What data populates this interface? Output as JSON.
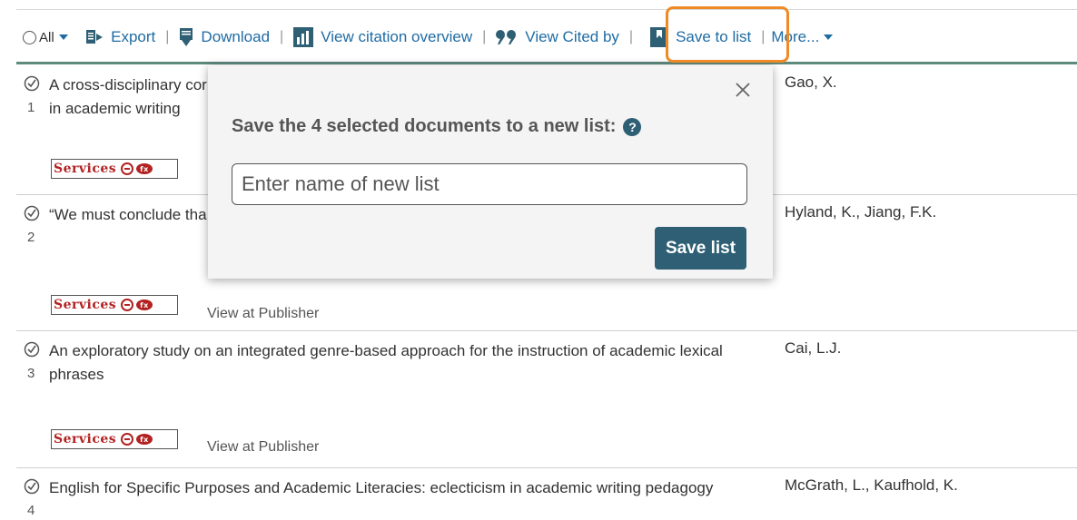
{
  "toolbar": {
    "select_all_label": "All",
    "export_label": "Export",
    "download_label": "Download",
    "citation_overview_label": "View citation overview",
    "cited_by_label": "View Cited by",
    "save_to_list_label": "Save to list",
    "more_label": "More...",
    "link_color": "#1f6ba3"
  },
  "popup": {
    "title": "Save the 4 selected documents to a new list:",
    "help_glyph": "?",
    "input_placeholder": "Enter name of new list",
    "input_value": "",
    "save_button_label": "Save list",
    "accent_color": "#2e5f74"
  },
  "highlight_color": "#f08a24",
  "results": [
    {
      "number": "1",
      "title": "A cross-disciplinary cor",
      "title_line2": "in academic writing",
      "authors": "Gao, X.",
      "services_label": "Services",
      "view_publisher": ""
    },
    {
      "number": "2",
      "title": "“We must conclude tha",
      "title_line2": "",
      "authors": "Hyland, K., Jiang, F.K.",
      "services_label": "Services",
      "view_publisher": "View at Publisher"
    },
    {
      "number": "3",
      "title": "An exploratory study on an integrated genre-based approach for the instruction of academic lexical",
      "title_line2": "phrases",
      "authors": "Cai, L.J.",
      "services_label": "Services",
      "view_publisher": "View at Publisher"
    },
    {
      "number": "4",
      "title": "English for Specific Purposes and Academic Literacies: eclecticism in academic writing pedagogy",
      "title_line2": "",
      "authors": "McGrath, L., Kaufhold, K.",
      "services_label": "",
      "view_publisher": ""
    }
  ]
}
